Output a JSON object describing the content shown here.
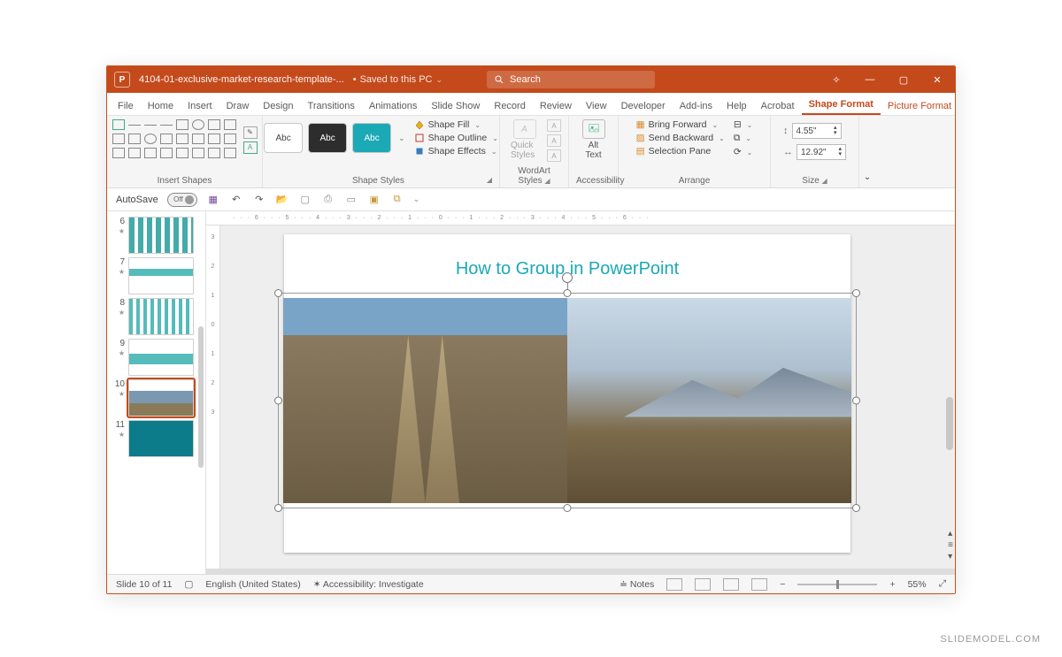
{
  "titlebar": {
    "docname": "4104-01-exclusive-market-research-template-...",
    "saved": "Saved to this PC",
    "search_placeholder": "Search"
  },
  "tabs": [
    "File",
    "Home",
    "Insert",
    "Draw",
    "Design",
    "Transitions",
    "Animations",
    "Slide Show",
    "Record",
    "Review",
    "View",
    "Developer",
    "Add-ins",
    "Help",
    "Acrobat",
    "Shape Format",
    "Picture Format"
  ],
  "active_tab": "Shape Format",
  "ribbon": {
    "insert_shapes": "Insert Shapes",
    "shape_styles": "Shape Styles",
    "sample": "Abc",
    "shape_fill": "Shape Fill",
    "shape_outline": "Shape Outline",
    "shape_effects": "Shape Effects",
    "wordart": "WordArt Styles",
    "quick_styles": "Quick Styles",
    "accessibility": "Accessibility",
    "alt_text": "Alt Text",
    "arrange": "Arrange",
    "bring_forward": "Bring Forward",
    "send_backward": "Send Backward",
    "selection_pane": "Selection Pane",
    "size": "Size",
    "height": "4.55\"",
    "width": "12.92\""
  },
  "qat": {
    "autosave": "AutoSave",
    "autosave_state": "Off"
  },
  "thumbs": [
    {
      "n": "6"
    },
    {
      "n": "7"
    },
    {
      "n": "8"
    },
    {
      "n": "9"
    },
    {
      "n": "10",
      "selected": true
    },
    {
      "n": "11",
      "teal": true
    }
  ],
  "slide": {
    "title": "How to Group in PowerPoint"
  },
  "status": {
    "slide": "Slide 10 of 11",
    "lang": "English (United States)",
    "access": "Accessibility: Investigate",
    "notes": "Notes",
    "zoom": "55%"
  },
  "watermark": "SLIDEMODEL.COM"
}
